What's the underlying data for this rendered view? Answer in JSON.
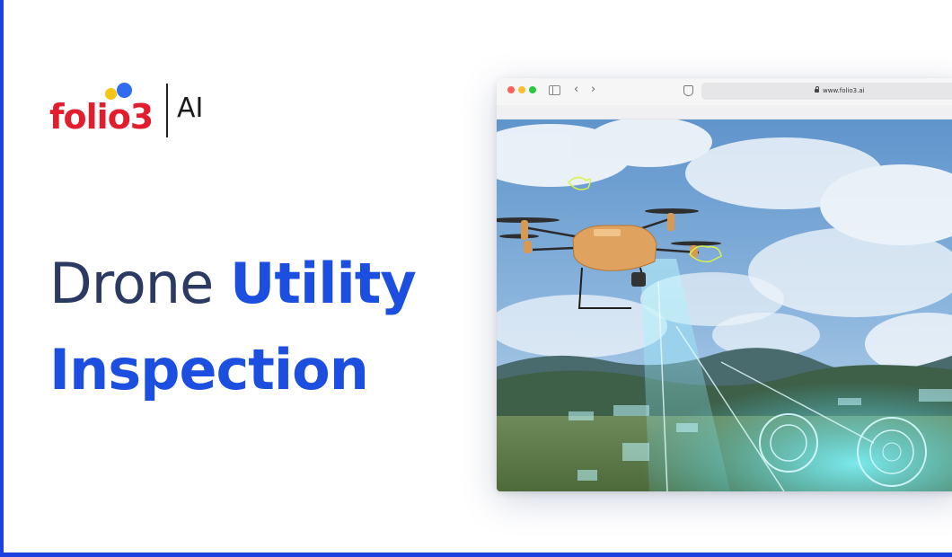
{
  "logo": {
    "wordmark": "folio3",
    "suffix": "AI"
  },
  "headline": {
    "line1_dark": "Drone",
    "line1_blue": "Utility",
    "line2_blue": "Inspection"
  },
  "browser": {
    "url": "www.folio3.ai"
  },
  "colors": {
    "accent_blue": "#1c4fe0",
    "headline_dark": "#2b3a63",
    "logo_red": "#e11d2e",
    "logo_yellow": "#f5c518",
    "logo_blue": "#2f6cf0",
    "frame_blue": "#1e40e0"
  }
}
